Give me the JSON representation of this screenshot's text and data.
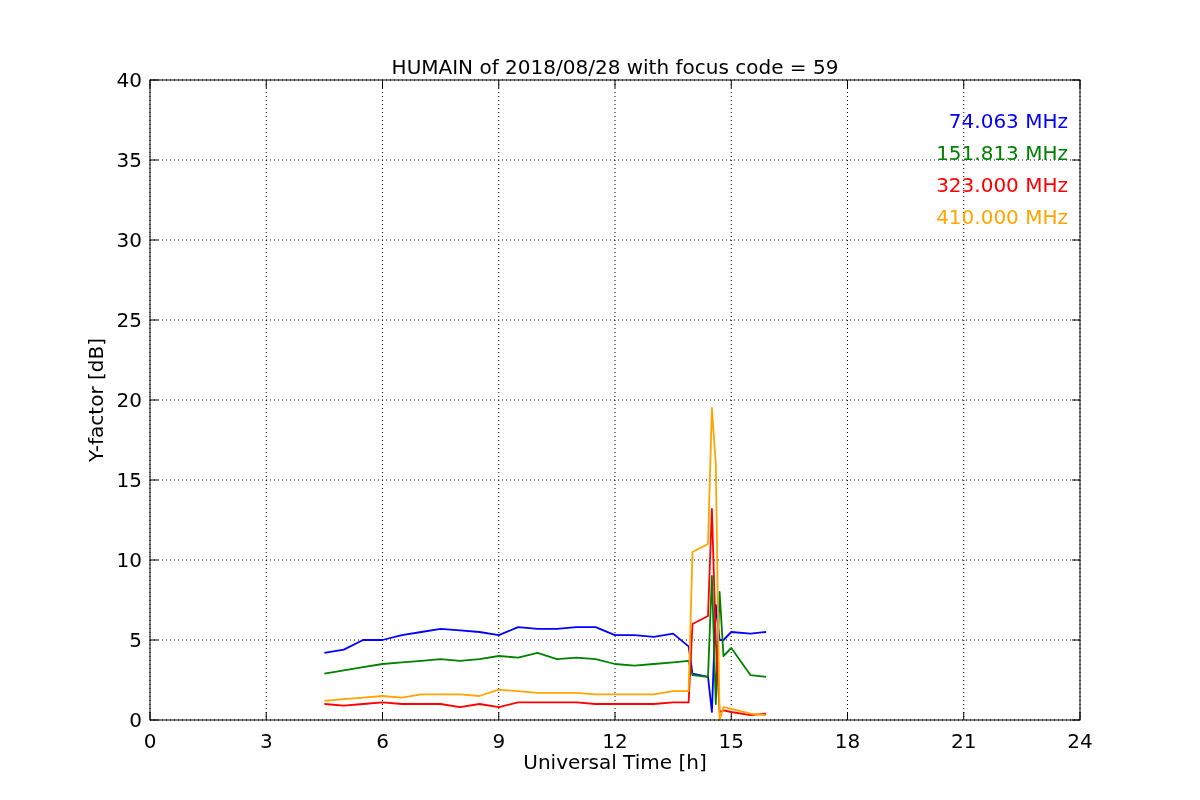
{
  "figure": {
    "chart_data": {
      "type": "line",
      "title": "HUMAIN of 2018/08/28 with focus code = 59",
      "xlabel": "Universal Time [h]",
      "ylabel": "Y-factor [dB]",
      "x": [
        4.5,
        5,
        5.5,
        6,
        6.5,
        7,
        7.5,
        8,
        8.5,
        9,
        9.5,
        10,
        10.5,
        11,
        11.5,
        12,
        12.5,
        13,
        13.5,
        13.9,
        14,
        14.4,
        14.5,
        14.6,
        14.7,
        14.8,
        15,
        15.5,
        15.9
      ],
      "series": [
        {
          "name": "74.063 MHz",
          "color": "#0000ff",
          "values": [
            4.2,
            4.4,
            5.0,
            5.0,
            5.3,
            5.5,
            5.7,
            5.6,
            5.5,
            5.3,
            5.8,
            5.7,
            5.7,
            5.8,
            5.8,
            5.3,
            5.3,
            5.2,
            5.4,
            4.6,
            2.9,
            2.7,
            0.5,
            7.2,
            5.0,
            5.0,
            5.5,
            5.4,
            5.5
          ]
        },
        {
          "name": "151.813 MHz",
          "color": "#008000",
          "values": [
            2.9,
            3.1,
            3.3,
            3.5,
            3.6,
            3.7,
            3.8,
            3.7,
            3.8,
            4.0,
            3.9,
            4.2,
            3.8,
            3.9,
            3.8,
            3.5,
            3.4,
            3.5,
            3.6,
            3.7,
            2.8,
            2.7,
            9.0,
            1.0,
            8.0,
            4.0,
            4.5,
            2.8,
            2.7
          ]
        },
        {
          "name": "323.000 MHz",
          "color": "#ff0000",
          "values": [
            1.0,
            0.9,
            1.0,
            1.1,
            1.0,
            1.0,
            1.0,
            0.8,
            1.0,
            0.8,
            1.1,
            1.1,
            1.1,
            1.1,
            1.0,
            1.0,
            1.0,
            1.0,
            1.1,
            1.1,
            6.0,
            6.5,
            13.2,
            5.0,
            0.5,
            0.6,
            0.5,
            0.3,
            0.4
          ]
        },
        {
          "name": "410.000 MHz",
          "color": "#ffa500",
          "values": [
            1.2,
            1.3,
            1.4,
            1.5,
            1.4,
            1.6,
            1.6,
            1.6,
            1.5,
            1.9,
            1.8,
            1.7,
            1.7,
            1.7,
            1.6,
            1.6,
            1.6,
            1.6,
            1.8,
            1.8,
            10.5,
            11.0,
            19.5,
            16.0,
            0.0,
            0.8,
            0.7,
            0.4,
            0.3
          ]
        }
      ],
      "xlim": [
        0,
        24
      ],
      "ylim": [
        0,
        40
      ],
      "xticks": [
        0,
        3,
        6,
        9,
        12,
        15,
        18,
        21,
        24
      ],
      "yticks": [
        0,
        5,
        10,
        15,
        20,
        25,
        30,
        35,
        40
      ],
      "grid": true
    }
  }
}
